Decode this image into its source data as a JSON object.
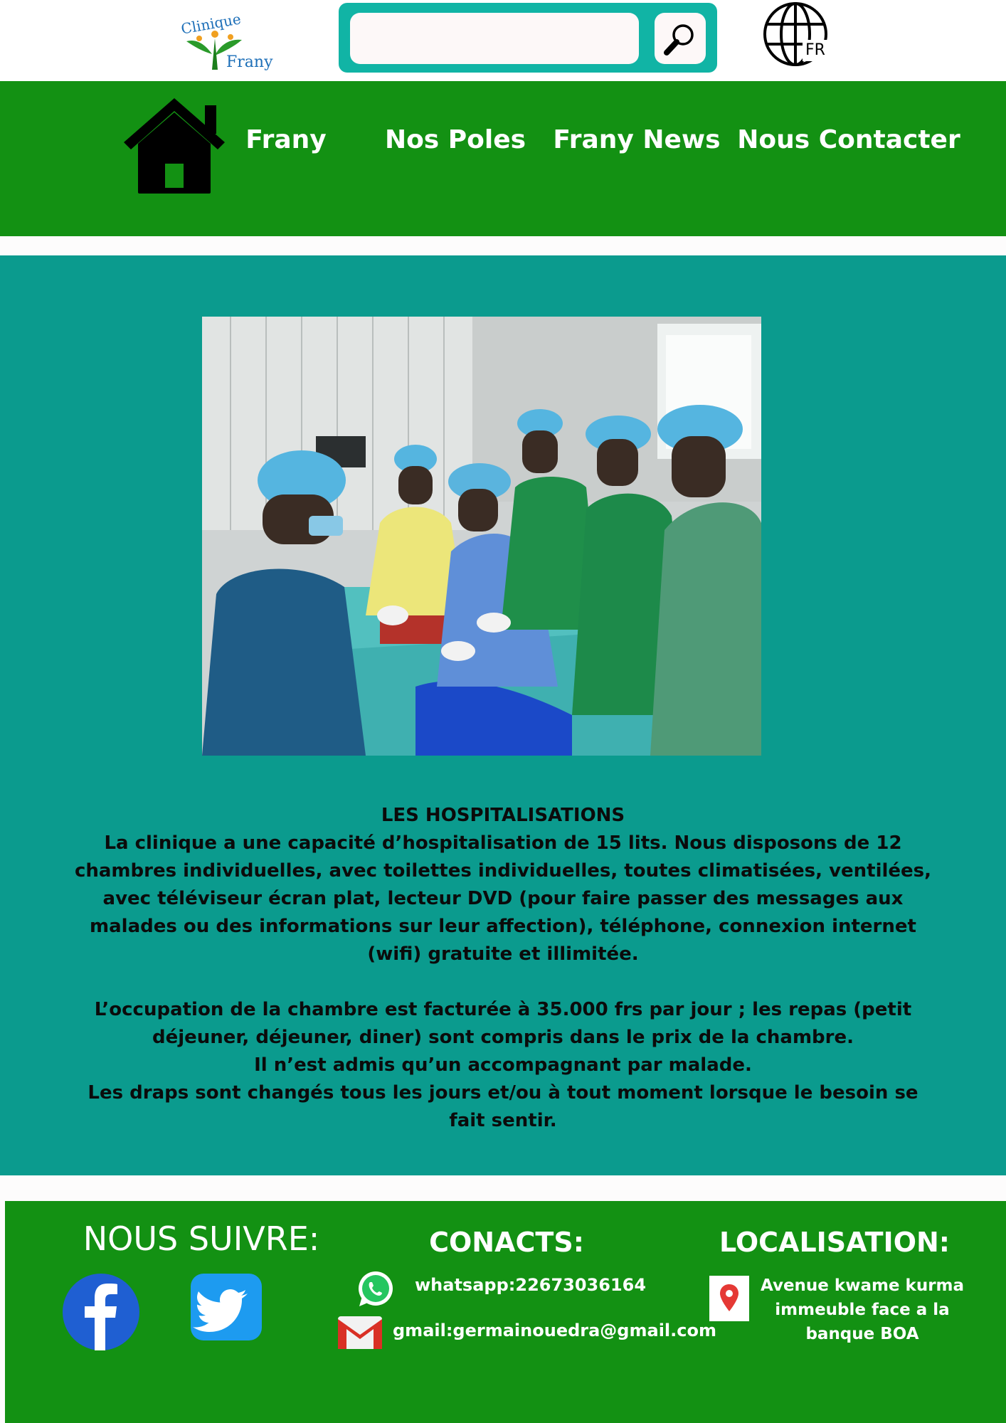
{
  "header": {
    "logo": {
      "text_top": "Clinique",
      "text_bottom": "Frany"
    },
    "search": {
      "value": "",
      "placeholder": ""
    },
    "language": {
      "code": "FR",
      "icon": "globe-icon"
    },
    "search_icon": "magnifier-icon"
  },
  "nav": {
    "home_icon": "house-icon",
    "items": [
      {
        "label": "Frany"
      },
      {
        "label": "Nos Poles"
      },
      {
        "label": "Frany News"
      },
      {
        "label": "Nous Contacter"
      }
    ]
  },
  "main": {
    "photo": {
      "subject": "medical-team-operating-room"
    },
    "title": "LES HOSPITALISATIONS",
    "paragraph1": "La clinique a une capacité d’hospitalisation de 15 lits. Nous disposons de 12 chambres individuelles, avec toilettes individuelles, toutes climatisées, ventilées, avec téléviseur écran plat, lecteur DVD (pour faire passer des messages aux malades ou des informations sur leur affection), téléphone, connexion internet (wifi) gratuite et illimitée.",
    "paragraph2": "L’occupation de la chambre est facturée à 35.000 frs par jour ; les repas (petit déjeuner, déjeuner, diner) sont compris dans le prix de la chambre.",
    "paragraph3": "Il n’est admis qu’un  accompagnant par malade.",
    "paragraph4": "Les draps sont changés tous les jours et/ou à tout moment lorsque le besoin se fait sentir."
  },
  "footer": {
    "follow_title": "NOUS SUIVRE:",
    "contacts_title": "CONACTS:",
    "location_title": "LOCALISATION:",
    "whatsapp": "whatsapp:22673036164",
    "gmail": "gmail:germainouedra@gmail.com",
    "address": "Avenue kwame kurma immeuble face a la banque BOA",
    "icons": [
      "facebook-icon",
      "twitter-icon",
      "whatsapp-icon",
      "gmail-icon",
      "location-pin-icon"
    ]
  },
  "colors": {
    "nav_green": "#139113",
    "teal": "#0b9b8e",
    "search_teal": "#11b4a5",
    "white": "#ffffff"
  }
}
